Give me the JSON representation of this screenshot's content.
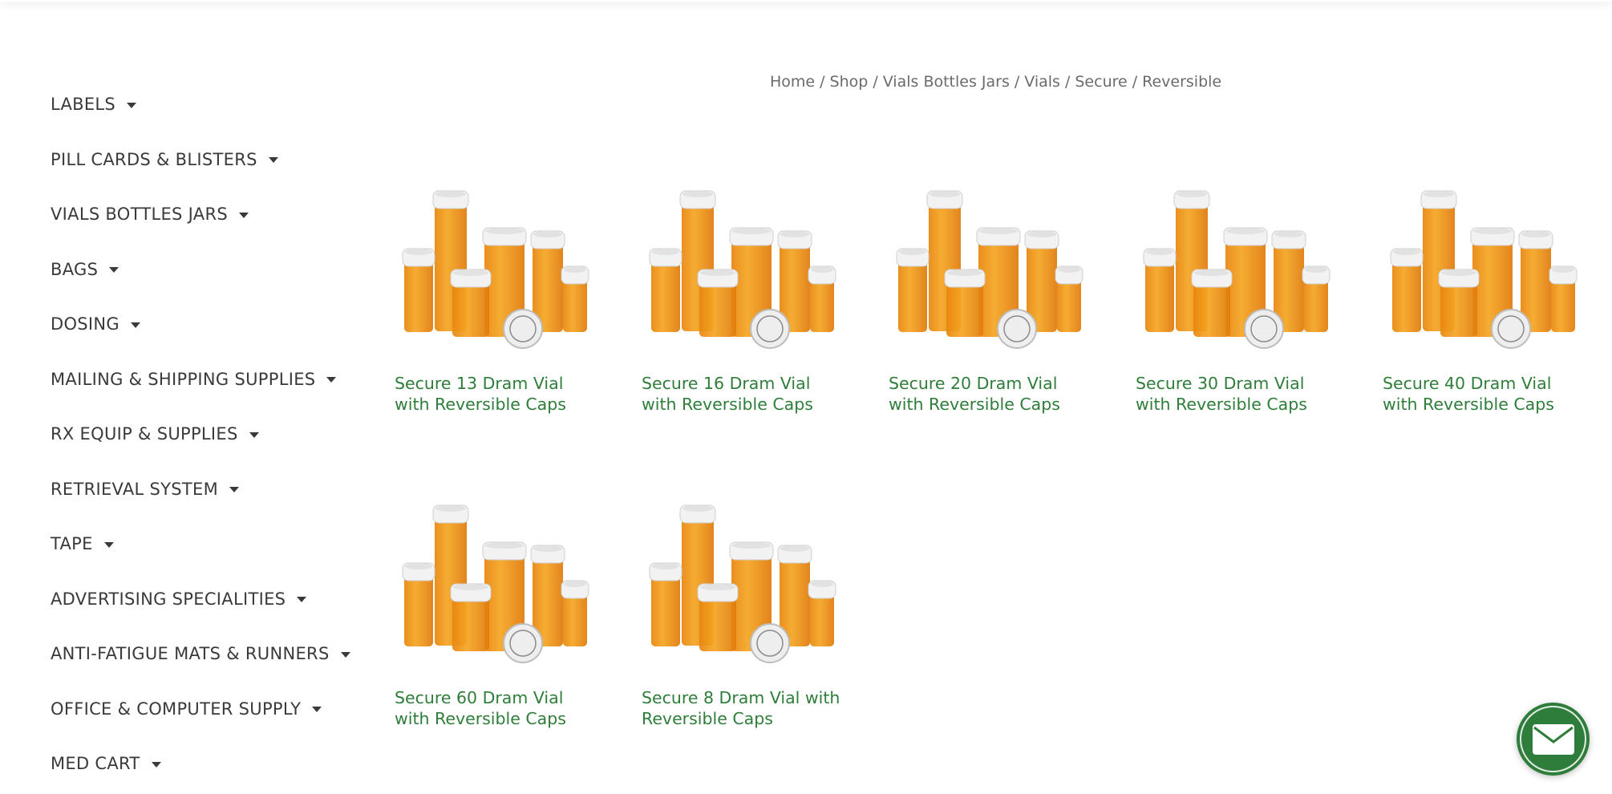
{
  "sidebar": {
    "categories": [
      {
        "label": "LABELS"
      },
      {
        "label": "PILL CARDS & BLISTERS"
      },
      {
        "label": "VIALS BOTTLES JARS"
      },
      {
        "label": "BAGS"
      },
      {
        "label": "DOSING"
      },
      {
        "label": "MAILING & SHIPPING SUPPLIES"
      },
      {
        "label": "RX EQUIP & SUPPLIES"
      },
      {
        "label": "RETRIEVAL SYSTEM"
      },
      {
        "label": "TAPE"
      },
      {
        "label": "ADVERTISING SPECIALITIES"
      },
      {
        "label": "ANTI-FATIGUE MATS & RUNNERS"
      },
      {
        "label": "OFFICE & COMPUTER SUPPLY"
      },
      {
        "label": "MED CART"
      }
    ],
    "expand_icon": "caret-down-icon"
  },
  "breadcrumb": {
    "items": [
      "Home",
      "Shop",
      "Vials Bottles Jars",
      "Vials",
      "Secure"
    ],
    "current": "Reversible",
    "separator": "/"
  },
  "products": [
    {
      "title": "Secure 13 Dram Vial with Reversible Caps"
    },
    {
      "title": "Secure 16 Dram Vial with Reversible Caps"
    },
    {
      "title": "Secure 20 Dram Vial with Reversible Caps"
    },
    {
      "title": "Secure 30 Dram Vial with Reversible Caps"
    },
    {
      "title": "Secure 40 Dram Vial with Reversible Caps"
    },
    {
      "title": "Secure 60 Dram Vial with Reversible Caps"
    },
    {
      "title": "Secure 8 Dram Vial with Reversible Caps"
    }
  ],
  "chat": {
    "icon": "mail-icon"
  },
  "colors": {
    "accent_green": "#2e7d3a",
    "vial_orange": "#f5a623",
    "cap_white": "#f2f2f2",
    "text_gray": "#3a3a3a"
  }
}
